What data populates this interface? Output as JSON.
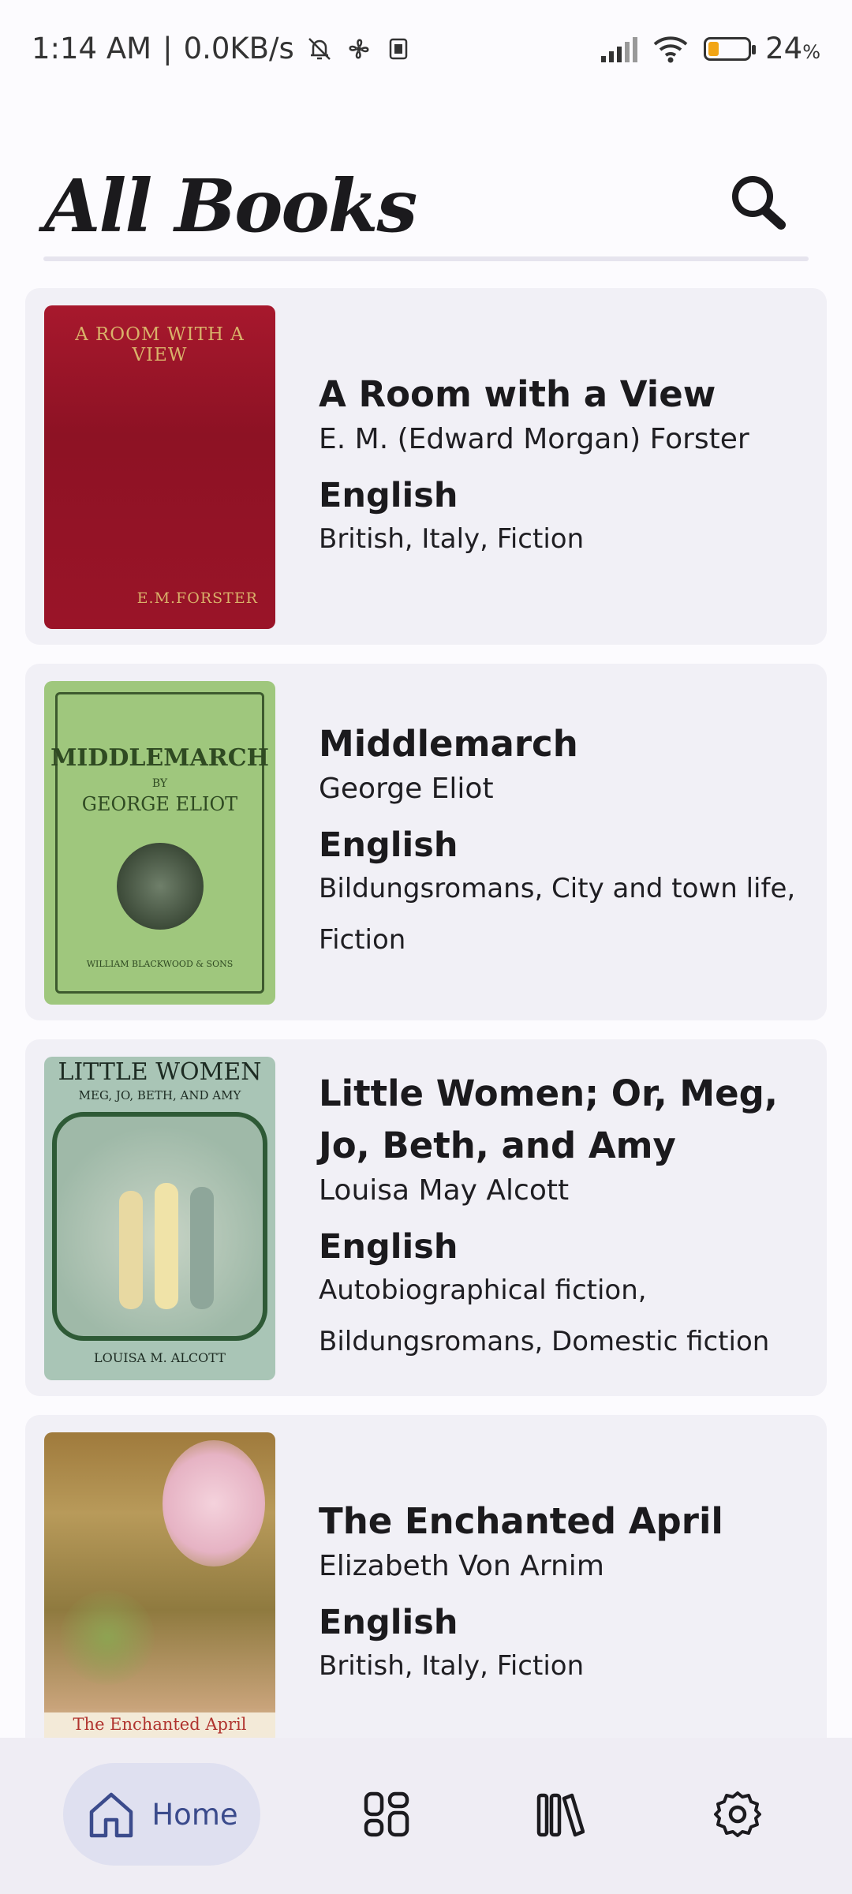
{
  "status_bar": {
    "time": "1:14 AM",
    "separator": "|",
    "speed": "0.0KB/s",
    "battery_percent": "24",
    "battery_unit": "%",
    "icons": [
      "mute-icon",
      "fan-icon",
      "dual-sim-icon",
      "signal-icon",
      "wifi-icon",
      "battery-icon"
    ]
  },
  "header": {
    "title": "All Books",
    "search_icon": "search-icon"
  },
  "books": [
    {
      "title": "A Room with a View",
      "author": "E. M. (Edward Morgan) Forster",
      "language": "English",
      "subjects": "British, Italy, Fiction",
      "cover_title": "A ROOM WITH A VIEW",
      "cover_author": "E.M.FORSTER"
    },
    {
      "title": "Middlemarch",
      "author": "George Eliot",
      "language": "English",
      "subjects": "Bildungsromans, City and town life, Fiction",
      "cover_title": "MIDDLEMARCH",
      "cover_by": "BY",
      "cover_author": "GEORGE ELIOT",
      "cover_publisher": "WILLIAM BLACKWOOD & SONS"
    },
    {
      "title": "Little Women; Or, Meg, Jo, Beth, and Amy",
      "author": "Louisa May Alcott",
      "language": "English",
      "subjects": "Autobiographical fiction, Bildungsromans, Domestic fiction",
      "cover_title": "LITTLE WOMEN",
      "cover_subtitle": "MEG, JO, BETH, AND AMY",
      "cover_author": "LOUISA M. ALCOTT"
    },
    {
      "title": "The Enchanted April",
      "author": "Elizabeth Von Arnim",
      "language": "English",
      "subjects": "British, Italy, Fiction",
      "cover_title": "The Enchanted April"
    }
  ],
  "bottom_nav": {
    "items": [
      {
        "label": "Home",
        "icon": "home-icon",
        "selected": true
      },
      {
        "label": "",
        "icon": "categories-icon",
        "selected": false
      },
      {
        "label": "",
        "icon": "library-icon",
        "selected": false
      },
      {
        "label": "",
        "icon": "settings-icon",
        "selected": false
      }
    ]
  },
  "colors": {
    "background": "#fcfbfe",
    "card": "#f1f0f6",
    "nav_bar": "#efedf4",
    "nav_selected_pill": "#dfe0f0",
    "nav_selected_label": "#3b4b8c",
    "battery_fill": "#f2a515"
  }
}
